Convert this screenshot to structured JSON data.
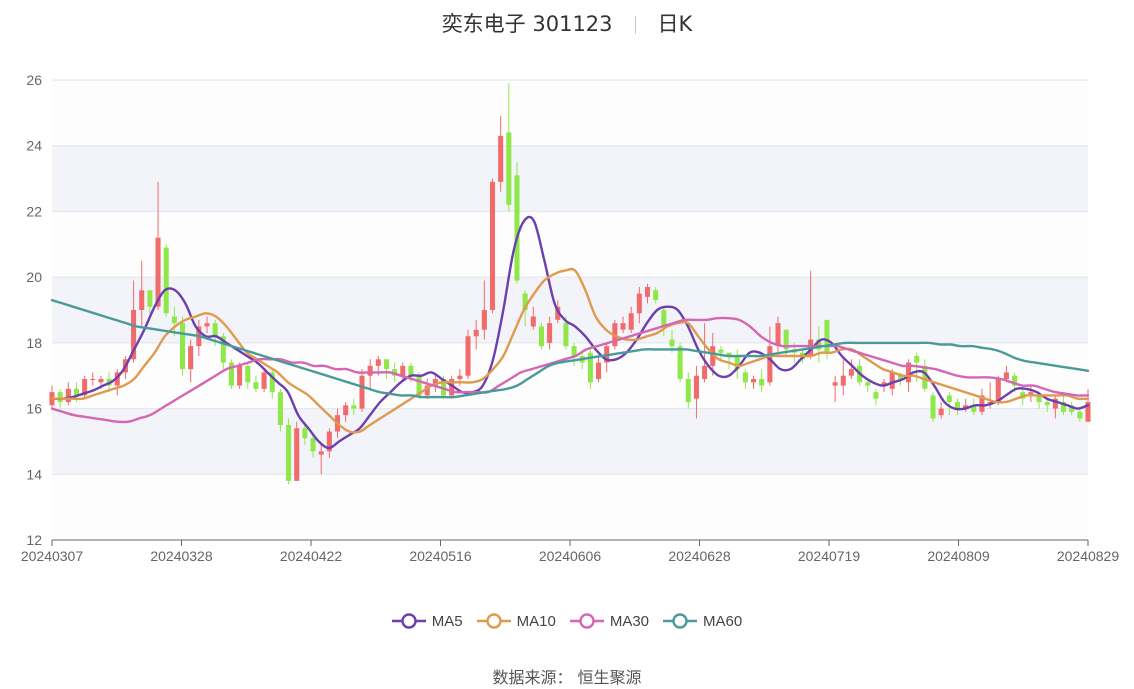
{
  "title": {
    "name": "奕东电子 301123",
    "period": "日K"
  },
  "source": "数据来源： 恒生聚源",
  "colors": {
    "up": "#f26b6b",
    "down": "#8fe84a",
    "MA5": "#6c3fb0",
    "MA10": "#e09a4e",
    "MA30": "#d566b4",
    "MA60": "#4a9a9a"
  },
  "chart_data": {
    "type": "candlestick",
    "ylim": [
      12,
      26
    ],
    "y_ticks": [
      "12",
      "14",
      "16",
      "18",
      "20",
      "22",
      "24",
      "26"
    ],
    "x_ticks": [
      "20240307",
      "20240328",
      "20240422",
      "20240516",
      "20240606",
      "20240628",
      "20240719",
      "20240809",
      "20240829"
    ],
    "legend": [
      "MA5",
      "MA10",
      "MA30",
      "MA60"
    ],
    "candles": [
      [
        16.1,
        16.5,
        16.7,
        16.0
      ],
      [
        16.5,
        16.2,
        16.6,
        16.0
      ],
      [
        16.2,
        16.6,
        16.8,
        16.1
      ],
      [
        16.6,
        16.4,
        16.8,
        16.2
      ],
      [
        16.4,
        16.9,
        17.0,
        16.3
      ],
      [
        16.9,
        16.9,
        17.1,
        16.7
      ],
      [
        16.8,
        16.9,
        17.0,
        16.6
      ],
      [
        16.9,
        16.7,
        17.1,
        16.5
      ],
      [
        16.7,
        17.1,
        17.2,
        16.4
      ],
      [
        17.1,
        17.5,
        17.6,
        16.9
      ],
      [
        17.5,
        19.0,
        19.9,
        17.4
      ],
      [
        19.0,
        19.6,
        20.5,
        18.5
      ],
      [
        19.6,
        19.1,
        19.5,
        18.9
      ],
      [
        19.1,
        21.2,
        22.9,
        19.0
      ],
      [
        20.9,
        18.9,
        21.0,
        18.8
      ],
      [
        18.8,
        18.6,
        19.1,
        18.2
      ],
      [
        18.6,
        17.2,
        18.8,
        17.0
      ],
      [
        17.2,
        17.9,
        18.1,
        16.8
      ],
      [
        17.9,
        18.5,
        18.7,
        17.6
      ],
      [
        18.5,
        18.6,
        18.8,
        18.3
      ],
      [
        18.6,
        18.2,
        18.7,
        17.9
      ],
      [
        18.2,
        17.4,
        18.3,
        17.2
      ],
      [
        17.4,
        16.7,
        17.5,
        16.6
      ],
      [
        16.7,
        17.3,
        17.4,
        16.6
      ],
      [
        17.3,
        16.8,
        17.4,
        16.6
      ],
      [
        16.8,
        16.6,
        17.0,
        16.5
      ],
      [
        16.6,
        17.1,
        17.2,
        16.5
      ],
      [
        17.1,
        16.5,
        17.2,
        16.3
      ],
      [
        16.5,
        15.5,
        16.6,
        15.3
      ],
      [
        15.5,
        13.8,
        15.7,
        13.7
      ],
      [
        13.8,
        15.4,
        15.6,
        13.8
      ],
      [
        15.4,
        15.1,
        15.6,
        14.9
      ],
      [
        15.1,
        14.7,
        15.2,
        14.5
      ],
      [
        14.6,
        14.7,
        14.9,
        14.0
      ],
      [
        14.7,
        15.3,
        15.4,
        14.5
      ],
      [
        15.3,
        15.8,
        16.0,
        15.1
      ],
      [
        15.8,
        16.1,
        16.2,
        15.6
      ],
      [
        16.1,
        16.0,
        16.3,
        15.8
      ],
      [
        16.0,
        17.0,
        17.2,
        15.9
      ],
      [
        17.0,
        17.3,
        17.5,
        16.6
      ],
      [
        17.3,
        17.5,
        17.6,
        17.0
      ],
      [
        17.5,
        17.2,
        17.5,
        16.9
      ],
      [
        17.2,
        17.0,
        17.4,
        16.8
      ],
      [
        17.0,
        17.3,
        17.4,
        16.8
      ],
      [
        17.3,
        17.0,
        17.4,
        16.8
      ],
      [
        17.0,
        16.4,
        17.1,
        16.3
      ],
      [
        16.4,
        16.7,
        16.9,
        16.3
      ],
      [
        16.7,
        16.9,
        17.0,
        16.5
      ],
      [
        16.9,
        16.4,
        17.0,
        16.3
      ],
      [
        16.4,
        16.9,
        17.0,
        16.3
      ],
      [
        16.9,
        17.0,
        17.2,
        16.7
      ],
      [
        17.0,
        18.2,
        18.4,
        16.9
      ],
      [
        18.2,
        18.4,
        18.7,
        17.8
      ],
      [
        18.4,
        19.0,
        19.9,
        18.1
      ],
      [
        19.0,
        22.9,
        23.0,
        18.9
      ],
      [
        22.9,
        24.3,
        24.9,
        22.6
      ],
      [
        24.4,
        22.2,
        25.9,
        22.0
      ],
      [
        23.1,
        19.9,
        23.5,
        19.8
      ],
      [
        19.5,
        19.0,
        19.6,
        18.5
      ],
      [
        18.5,
        18.8,
        19.1,
        18.4
      ],
      [
        18.5,
        17.9,
        18.6,
        17.8
      ],
      [
        18.0,
        18.6,
        18.8,
        17.8
      ],
      [
        18.7,
        19.1,
        19.3,
        18.6
      ],
      [
        18.6,
        17.9,
        18.8,
        17.8
      ],
      [
        17.9,
        17.6,
        18.0,
        17.3
      ],
      [
        17.6,
        17.4,
        17.7,
        17.2
      ],
      [
        17.7,
        16.8,
        17.8,
        16.6
      ],
      [
        16.9,
        17.4,
        17.6,
        16.8
      ],
      [
        17.4,
        17.9,
        18.0,
        17.1
      ],
      [
        17.9,
        18.6,
        18.7,
        17.8
      ],
      [
        18.4,
        18.6,
        18.8,
        18.3
      ],
      [
        18.4,
        18.9,
        19.1,
        18.3
      ],
      [
        18.9,
        19.5,
        19.7,
        18.6
      ],
      [
        19.4,
        19.7,
        19.8,
        19.2
      ],
      [
        19.6,
        19.3,
        19.7,
        19.2
      ],
      [
        19.0,
        18.5,
        19.1,
        18.2
      ],
      [
        18.1,
        17.9,
        18.4,
        17.7
      ],
      [
        17.9,
        16.9,
        18.0,
        16.8
      ],
      [
        16.9,
        16.2,
        17.1,
        16.0
      ],
      [
        16.3,
        17.0,
        17.3,
        15.7
      ],
      [
        16.9,
        17.3,
        18.6,
        16.8
      ],
      [
        17.3,
        17.9,
        18.3,
        17.0
      ],
      [
        17.8,
        17.7,
        17.9,
        17.5
      ],
      [
        17.7,
        17.6,
        17.7,
        17.2
      ],
      [
        17.6,
        17.2,
        17.8,
        16.9
      ],
      [
        17.1,
        16.8,
        17.2,
        16.6
      ],
      [
        16.8,
        16.9,
        17.0,
        16.6
      ],
      [
        16.9,
        16.7,
        17.2,
        16.5
      ],
      [
        16.8,
        17.9,
        18.5,
        16.7
      ],
      [
        17.9,
        18.6,
        18.8,
        17.7
      ],
      [
        18.4,
        17.8,
        18.4,
        17.6
      ],
      [
        17.8,
        17.7,
        18.0,
        17.4
      ],
      [
        17.7,
        17.5,
        17.8,
        17.4
      ],
      [
        17.6,
        18.1,
        20.2,
        17.5
      ],
      [
        18.1,
        17.8,
        18.5,
        17.4
      ],
      [
        18.7,
        17.7,
        18.7,
        17.5
      ],
      [
        16.7,
        16.8,
        17.0,
        16.2
      ],
      [
        16.7,
        17.0,
        17.5,
        16.4
      ],
      [
        17.0,
        17.2,
        17.5,
        16.9
      ],
      [
        17.3,
        16.8,
        17.5,
        16.7
      ],
      [
        16.8,
        16.7,
        16.9,
        16.5
      ],
      [
        16.5,
        16.3,
        16.6,
        16.1
      ],
      [
        16.7,
        16.8,
        16.9,
        16.5
      ],
      [
        16.6,
        17.1,
        17.2,
        16.4
      ],
      [
        17.0,
        16.9,
        17.1,
        16.7
      ],
      [
        16.8,
        17.4,
        17.5,
        16.5
      ],
      [
        17.6,
        17.4,
        17.7,
        16.8
      ],
      [
        17.3,
        16.6,
        17.5,
        16.5
      ],
      [
        16.4,
        15.7,
        16.5,
        15.6
      ],
      [
        15.8,
        16.0,
        16.2,
        15.7
      ],
      [
        16.4,
        16.2,
        16.5,
        15.8
      ],
      [
        16.2,
        16.0,
        16.3,
        15.8
      ],
      [
        16.0,
        16.1,
        16.3,
        15.9
      ],
      [
        16.1,
        15.9,
        16.3,
        15.8
      ],
      [
        15.9,
        16.4,
        16.6,
        15.8
      ],
      [
        16.2,
        16.2,
        16.8,
        16.0
      ],
      [
        16.2,
        16.9,
        17.0,
        16.1
      ],
      [
        16.9,
        17.1,
        17.3,
        16.8
      ],
      [
        17.0,
        16.7,
        17.1,
        16.5
      ],
      [
        16.5,
        16.3,
        16.6,
        16.1
      ],
      [
        16.4,
        16.5,
        16.7,
        16.2
      ],
      [
        16.4,
        16.2,
        16.5,
        16.0
      ],
      [
        16.2,
        16.1,
        16.3,
        15.9
      ],
      [
        16.0,
        16.3,
        16.4,
        15.7
      ],
      [
        16.2,
        15.9,
        16.4,
        15.8
      ],
      [
        16.1,
        15.9,
        16.2,
        15.8
      ],
      [
        15.9,
        15.7,
        16.0,
        15.6
      ],
      [
        15.6,
        16.2,
        16.6,
        15.6
      ]
    ],
    "series": [
      {
        "name": "MA5",
        "values": [
          16.3,
          16.3,
          16.35,
          16.45,
          16.55,
          16.7,
          16.85,
          17.2,
          17.8,
          18.4,
          19.1,
          19.6,
          19.6,
          19.2,
          18.5,
          18.2,
          18.2,
          18.0,
          17.8,
          17.6,
          17.4,
          17.1,
          16.8,
          16.5,
          15.8,
          15.4,
          15.0,
          14.8,
          15.0,
          15.2,
          15.4,
          15.8,
          16.2,
          16.5,
          16.8,
          17.0,
          17.0,
          17.1,
          16.9,
          16.7,
          16.5,
          16.5,
          16.7,
          17.5,
          19.0,
          20.8,
          21.7,
          21.7,
          20.5,
          19.2,
          18.7,
          18.5,
          18.2,
          17.8,
          17.5,
          17.5,
          17.7,
          18.1,
          18.6,
          19.0,
          19.1,
          19.0,
          18.5,
          17.8,
          17.3,
          17.0,
          17.0,
          17.3,
          17.7,
          17.7,
          17.5,
          17.2,
          17.2,
          17.5,
          17.8,
          18.1,
          18.0,
          17.6,
          17.3,
          17.0,
          16.8,
          16.7,
          16.8,
          16.9,
          17.1,
          17.1,
          16.7,
          16.2,
          16.0,
          16.0,
          16.1,
          16.1,
          16.2,
          16.4,
          16.6,
          16.6,
          16.5,
          16.3,
          16.2,
          16.1,
          16.0,
          16.1
        ]
      },
      {
        "name": "MA10",
        "values": [
          16.3,
          16.3,
          16.3,
          16.3,
          16.4,
          16.5,
          16.6,
          16.7,
          16.9,
          17.3,
          17.7,
          18.2,
          18.5,
          18.7,
          18.8,
          18.9,
          18.8,
          18.5,
          18.1,
          17.7,
          17.5,
          17.3,
          17.1,
          16.8,
          16.6,
          16.4,
          16.1,
          15.8,
          15.5,
          15.3,
          15.3,
          15.5,
          15.7,
          15.9,
          16.1,
          16.3,
          16.5,
          16.7,
          16.8,
          16.8,
          16.8,
          16.8,
          16.9,
          17.2,
          17.6,
          18.3,
          19.0,
          19.5,
          19.9,
          20.1,
          20.2,
          20.2,
          19.6,
          18.8,
          18.4,
          18.2,
          18.1,
          18.1,
          18.2,
          18.3,
          18.5,
          18.6,
          18.6,
          18.2,
          17.8,
          17.5,
          17.4,
          17.3,
          17.4,
          17.5,
          17.6,
          17.6,
          17.6,
          17.6,
          17.6,
          17.7,
          17.7,
          17.8,
          17.8,
          17.6,
          17.4,
          17.2,
          17.1,
          17.0,
          17.0,
          16.9,
          16.8,
          16.7,
          16.6,
          16.5,
          16.4,
          16.3,
          16.2,
          16.2,
          16.3,
          16.4,
          16.4,
          16.4,
          16.4,
          16.4,
          16.3,
          16.3
        ]
      },
      {
        "name": "MA30",
        "values": [
          16.0,
          15.9,
          15.8,
          15.75,
          15.7,
          15.65,
          15.6,
          15.6,
          15.7,
          15.8,
          16.0,
          16.2,
          16.4,
          16.6,
          16.8,
          17.0,
          17.2,
          17.3,
          17.4,
          17.5,
          17.5,
          17.5,
          17.4,
          17.4,
          17.3,
          17.3,
          17.2,
          17.2,
          17.1,
          17.1,
          17.1,
          17.1,
          17.0,
          16.9,
          16.8,
          16.7,
          16.6,
          16.5,
          16.5,
          16.5,
          16.5,
          16.7,
          16.9,
          17.1,
          17.2,
          17.3,
          17.4,
          17.5,
          17.6,
          17.8,
          17.9,
          18.0,
          18.1,
          18.2,
          18.3,
          18.4,
          18.5,
          18.6,
          18.7,
          18.7,
          18.7,
          18.75,
          18.75,
          18.7,
          18.5,
          18.2,
          18.0,
          17.9,
          17.9,
          17.9,
          17.9,
          17.9,
          17.9,
          17.8,
          17.7,
          17.6,
          17.5,
          17.4,
          17.3,
          17.3,
          17.25,
          17.2,
          17.1,
          17.0,
          16.95,
          16.95,
          16.95,
          16.9,
          16.8,
          16.7,
          16.7,
          16.6,
          16.5,
          16.45,
          16.4,
          16.4
        ]
      },
      {
        "name": "MA60",
        "values": [
          19.3,
          19.2,
          19.1,
          19.0,
          18.9,
          18.8,
          18.7,
          18.6,
          18.5,
          18.45,
          18.4,
          18.35,
          18.3,
          18.25,
          18.2,
          18.1,
          18.0,
          17.9,
          17.8,
          17.7,
          17.6,
          17.5,
          17.4,
          17.3,
          17.2,
          17.1,
          17.0,
          16.9,
          16.8,
          16.7,
          16.6,
          16.5,
          16.45,
          16.4,
          16.4,
          16.35,
          16.35,
          16.35,
          16.35,
          16.4,
          16.45,
          16.5,
          16.55,
          16.6,
          16.7,
          16.9,
          17.1,
          17.3,
          17.4,
          17.45,
          17.5,
          17.55,
          17.6,
          17.65,
          17.7,
          17.75,
          17.8,
          17.8,
          17.8,
          17.8,
          17.8,
          17.75,
          17.7,
          17.65,
          17.6,
          17.6,
          17.6,
          17.6,
          17.65,
          17.7,
          17.75,
          17.8,
          17.85,
          17.9,
          17.95,
          18.0,
          18.0,
          18.0,
          18.0,
          18.0,
          18.0,
          18.0,
          18.0,
          18.0,
          17.95,
          17.95,
          17.9,
          17.9,
          17.85,
          17.8,
          17.7,
          17.55,
          17.45,
          17.4,
          17.35,
          17.3,
          17.25,
          17.2,
          17.15
        ]
      }
    ]
  }
}
